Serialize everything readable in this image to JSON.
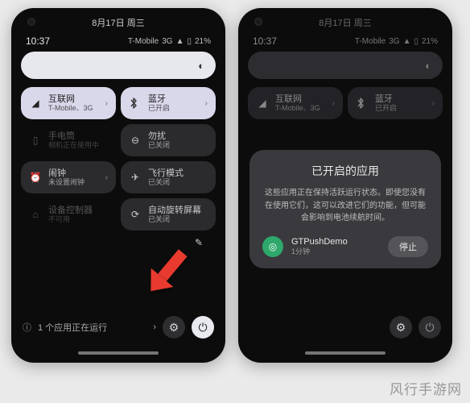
{
  "date_header": "8月17日 周三",
  "status": {
    "time": "10:37",
    "carrier": "T-Mobile",
    "net": "3G",
    "battery": "21%"
  },
  "tiles": {
    "internet": {
      "title": "互联网",
      "sub": "T-Mobile、3G"
    },
    "bluetooth": {
      "title": "蓝牙",
      "sub": "已开启"
    },
    "flashlight": {
      "title": "手电筒",
      "sub": "相机正在使用中"
    },
    "dnd": {
      "title": "勿扰",
      "sub": "已关闭"
    },
    "alarm": {
      "title": "闹钟",
      "sub": "未设置闹钟"
    },
    "airplane": {
      "title": "飞行模式",
      "sub": "已关闭"
    },
    "device": {
      "title": "设备控制器",
      "sub": "不可用"
    },
    "rotate": {
      "title": "自动旋转屏幕",
      "sub": "已关闭"
    }
  },
  "running": {
    "label": "1 个应用正在运行"
  },
  "dialog": {
    "title": "已开启的应用",
    "body": "这些应用正在保持活跃运行状态。即使您没有在使用它们，这可以改进它们的功能，但可能会影响到电池续航时间。",
    "app_name": "GTPushDemo",
    "app_duration": "1分钟",
    "stop": "停止"
  },
  "watermark": "风行手游网"
}
